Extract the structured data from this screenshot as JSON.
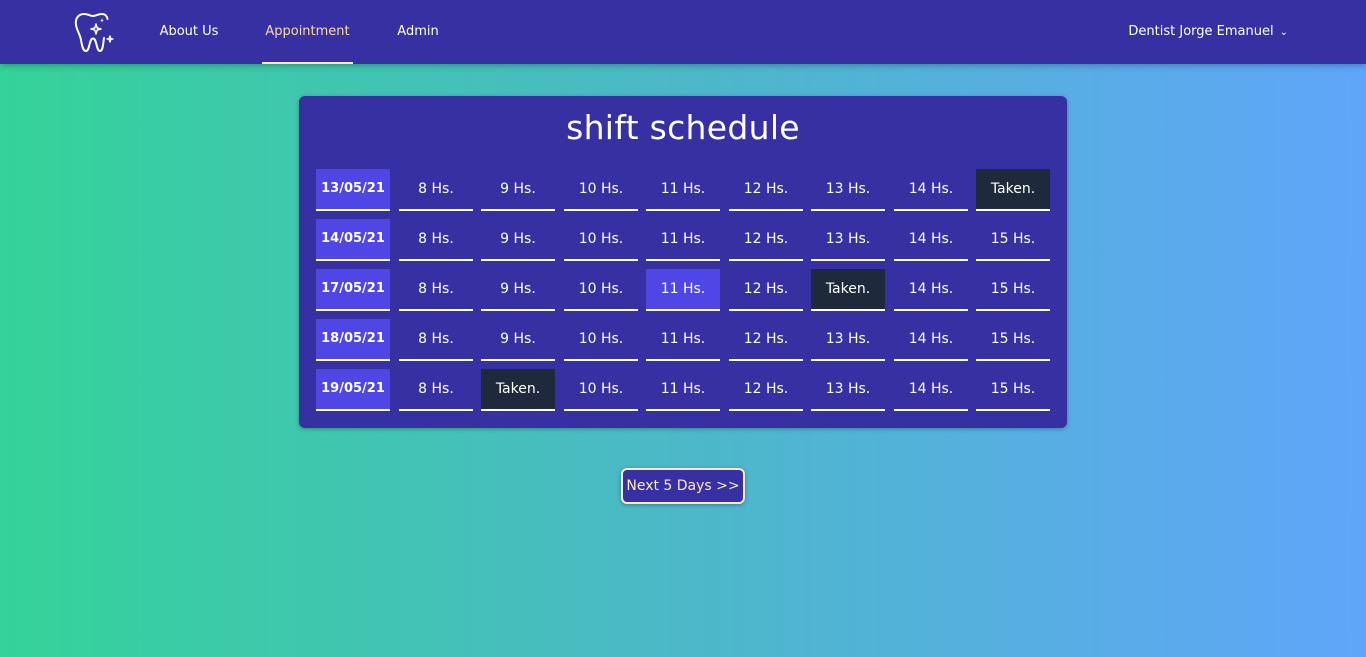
{
  "nav": {
    "links": [
      {
        "label": "About Us",
        "active": false
      },
      {
        "label": "Appointment",
        "active": true
      },
      {
        "label": "Admin",
        "active": false
      }
    ],
    "user_label": "Dentist Jorge Emanuel",
    "user_icon": "chevron-down-icon",
    "logo_icon": "tooth-sparkle-icon"
  },
  "colors": {
    "navbar": "#3730a3",
    "card": "#3730a3",
    "date_cell": "#4f46e5",
    "selected": "#4f46e5",
    "taken": "#1e293b",
    "active_link": "#fcd9a0",
    "gradient_start": "#34d399",
    "gradient_end": "#60a5fa"
  },
  "schedule": {
    "title": "shift schedule",
    "rows": [
      {
        "date": "13/05/21",
        "slots": [
          {
            "label": "8 Hs.",
            "state": "free"
          },
          {
            "label": "9 Hs.",
            "state": "free"
          },
          {
            "label": "10 Hs.",
            "state": "free"
          },
          {
            "label": "11 Hs.",
            "state": "free"
          },
          {
            "label": "12 Hs.",
            "state": "free"
          },
          {
            "label": "13 Hs.",
            "state": "free"
          },
          {
            "label": "14 Hs.",
            "state": "free"
          },
          {
            "label": "Taken.",
            "state": "taken"
          }
        ]
      },
      {
        "date": "14/05/21",
        "slots": [
          {
            "label": "8 Hs.",
            "state": "free"
          },
          {
            "label": "9 Hs.",
            "state": "free"
          },
          {
            "label": "10 Hs.",
            "state": "free"
          },
          {
            "label": "11 Hs.",
            "state": "free"
          },
          {
            "label": "12 Hs.",
            "state": "free"
          },
          {
            "label": "13 Hs.",
            "state": "free"
          },
          {
            "label": "14 Hs.",
            "state": "free"
          },
          {
            "label": "15 Hs.",
            "state": "free"
          }
        ]
      },
      {
        "date": "17/05/21",
        "slots": [
          {
            "label": "8 Hs.",
            "state": "free"
          },
          {
            "label": "9 Hs.",
            "state": "free"
          },
          {
            "label": "10 Hs.",
            "state": "free"
          },
          {
            "label": "11 Hs.",
            "state": "selected"
          },
          {
            "label": "12 Hs.",
            "state": "free"
          },
          {
            "label": "Taken.",
            "state": "taken"
          },
          {
            "label": "14 Hs.",
            "state": "free"
          },
          {
            "label": "15 Hs.",
            "state": "free"
          }
        ]
      },
      {
        "date": "18/05/21",
        "slots": [
          {
            "label": "8 Hs.",
            "state": "free"
          },
          {
            "label": "9 Hs.",
            "state": "free"
          },
          {
            "label": "10 Hs.",
            "state": "free"
          },
          {
            "label": "11 Hs.",
            "state": "free"
          },
          {
            "label": "12 Hs.",
            "state": "free"
          },
          {
            "label": "13 Hs.",
            "state": "free"
          },
          {
            "label": "14 Hs.",
            "state": "free"
          },
          {
            "label": "15 Hs.",
            "state": "free"
          }
        ]
      },
      {
        "date": "19/05/21",
        "slots": [
          {
            "label": "8 Hs.",
            "state": "free"
          },
          {
            "label": "Taken.",
            "state": "taken"
          },
          {
            "label": "10 Hs.",
            "state": "free"
          },
          {
            "label": "11 Hs.",
            "state": "free"
          },
          {
            "label": "12 Hs.",
            "state": "free"
          },
          {
            "label": "13 Hs.",
            "state": "free"
          },
          {
            "label": "14 Hs.",
            "state": "free"
          },
          {
            "label": "15 Hs.",
            "state": "free"
          }
        ]
      }
    ]
  },
  "next_button": "Next 5 Days >>"
}
